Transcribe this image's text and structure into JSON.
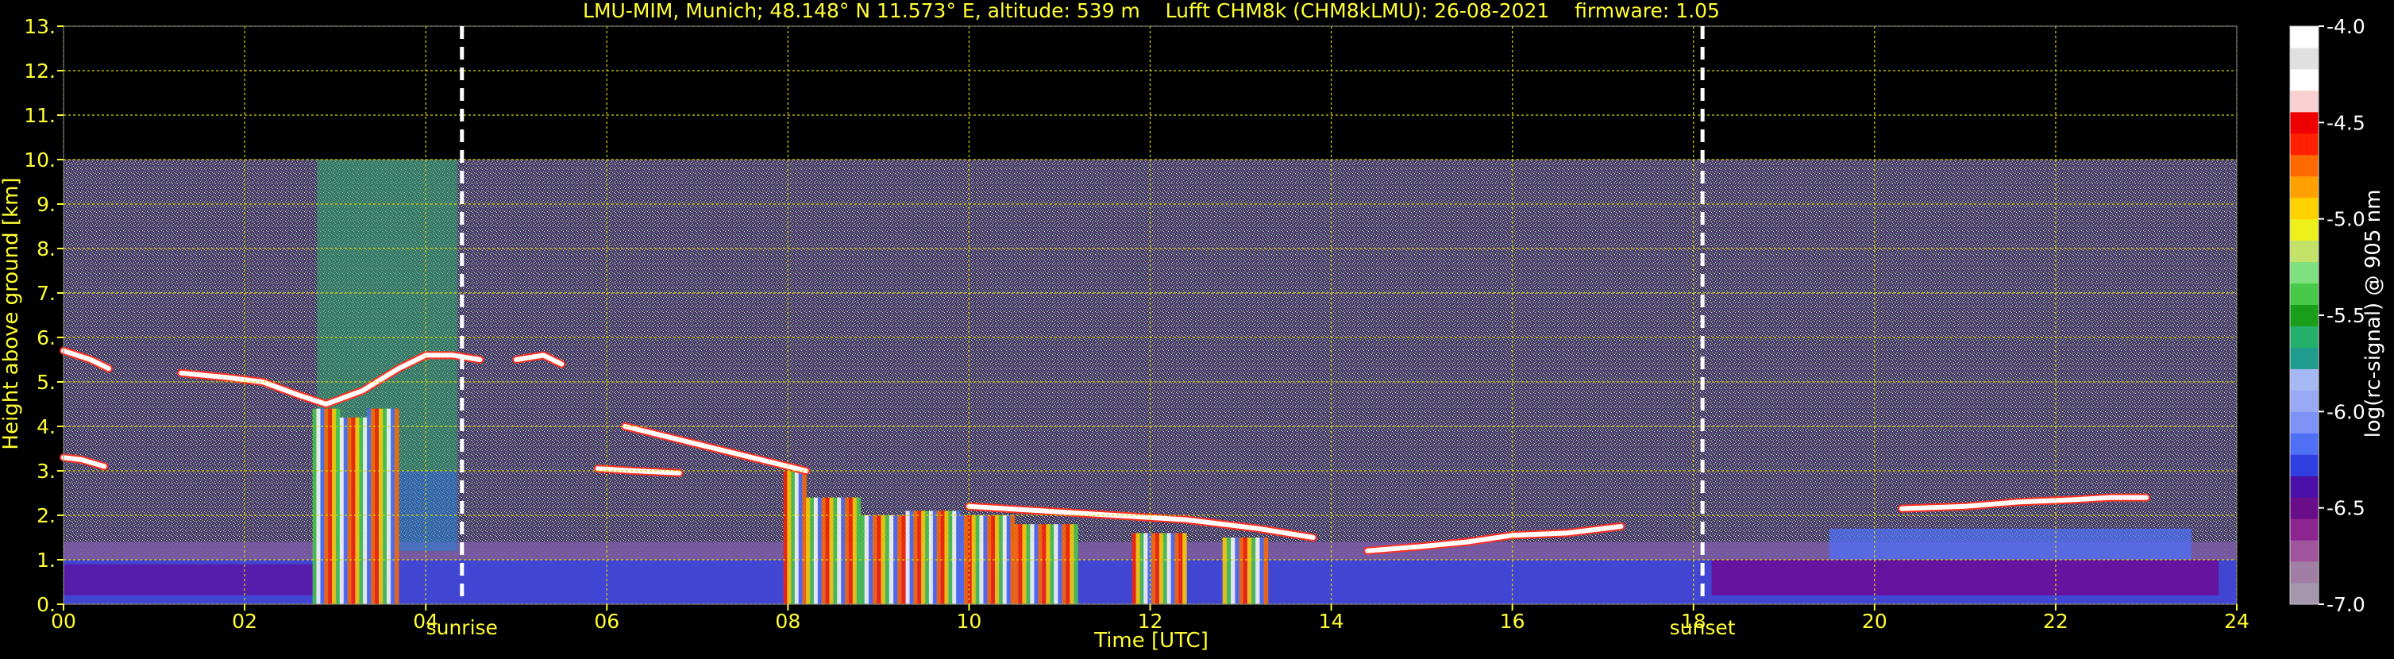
{
  "chart_data": {
    "type": "heatmap",
    "title": "LMU-MIM, Munich; 48.148° N 11.573° E, altitude: 539 m    Lufft CHM8k (CHM8kLMU): 26-08-2021    firmware: 1.05",
    "xlabel": "Time [UTC]",
    "ylabel": "Height above ground [km]",
    "xlim": [
      0,
      24
    ],
    "ylim": [
      0,
      13
    ],
    "xticks": [
      "00",
      "02",
      "04",
      "06",
      "08",
      "10",
      "12",
      "14",
      "16",
      "18",
      "20",
      "22",
      "24"
    ],
    "yticks": [
      "0.",
      "1.",
      "2.",
      "3.",
      "4.",
      "5.",
      "6.",
      "7.",
      "8.",
      "9.",
      "10.",
      "11.",
      "12.",
      "13."
    ],
    "grid": true,
    "max_range_km": 10,
    "markers": [
      {
        "label": "sunrise",
        "time": 4.4
      },
      {
        "label": "sunset",
        "time": 18.1
      }
    ],
    "colorbar": {
      "label": "log(rc-signal) @ 905 nm",
      "range": [
        -7.0,
        -4.0
      ],
      "ticks": [
        "-4.0",
        "-4.5",
        "-5.0",
        "-5.5",
        "-6.0",
        "-6.5",
        "-7.0"
      ],
      "tick_values": [
        -4.0,
        -4.5,
        -5.0,
        -5.5,
        -6.0,
        -6.5,
        -7.0
      ],
      "colors": [
        "#a595ad",
        "#a17fa4",
        "#a0549c",
        "#8c2590",
        "#6a0d8a",
        "#4a10a8",
        "#3040e0",
        "#4f6ff5",
        "#7f93f7",
        "#9aa9f5",
        "#a5b8f3",
        "#1f9c8d",
        "#24b06a",
        "#1a9e1a",
        "#48c94a",
        "#7ee07f",
        "#c4e26a",
        "#eef01c",
        "#ffd200",
        "#ffa000",
        "#ff6a00",
        "#ff2000",
        "#ee0000",
        "#f8d0d0",
        "#ffffff",
        "#e0e0e0",
        "#ffffff"
      ]
    },
    "cloud_layers": [
      {
        "t": [
          0.0,
          0.3,
          0.5
        ],
        "h": [
          5.7,
          5.5,
          5.3
        ]
      },
      {
        "t": [
          1.3,
          1.8,
          2.2,
          2.6,
          2.9,
          3.3,
          3.7,
          4.0,
          4.3,
          4.6
        ],
        "h": [
          5.2,
          5.1,
          5.0,
          4.7,
          4.5,
          4.8,
          5.3,
          5.6,
          5.6,
          5.5
        ]
      },
      {
        "t": [
          5.0,
          5.3,
          5.5
        ],
        "h": [
          5.5,
          5.6,
          5.4
        ]
      },
      {
        "t": [
          0.0,
          0.2,
          0.45
        ],
        "h": [
          3.3,
          3.25,
          3.1
        ]
      },
      {
        "t": [
          6.2,
          6.6,
          7.0,
          7.4,
          7.8,
          8.2
        ],
        "h": [
          4.0,
          3.8,
          3.6,
          3.4,
          3.2,
          3.0
        ]
      },
      {
        "t": [
          5.9,
          6.3,
          6.8
        ],
        "h": [
          3.05,
          3.0,
          2.95
        ]
      },
      {
        "t": [
          10.0,
          10.8,
          11.6,
          12.4,
          13.2,
          13.8
        ],
        "h": [
          2.2,
          2.1,
          2.0,
          1.9,
          1.7,
          1.5
        ]
      },
      {
        "t": [
          14.4,
          15.0,
          15.5,
          16.0,
          16.6,
          17.2
        ],
        "h": [
          1.2,
          1.3,
          1.4,
          1.55,
          1.6,
          1.75
        ]
      },
      {
        "t": [
          20.3,
          21.0,
          21.6,
          22.2,
          22.6,
          23.0
        ],
        "h": [
          2.15,
          2.2,
          2.3,
          2.35,
          2.4,
          2.4
        ]
      }
    ],
    "precip_columns": [
      {
        "t0": 7.95,
        "t1": 8.2,
        "top": 3.0
      },
      {
        "t0": 8.2,
        "t1": 8.8,
        "top": 2.4
      },
      {
        "t0": 8.8,
        "t1": 9.3,
        "top": 2.0
      },
      {
        "t0": 9.3,
        "t1": 9.9,
        "top": 2.1
      },
      {
        "t0": 9.9,
        "t1": 10.5,
        "top": 2.0
      },
      {
        "t0": 10.5,
        "t1": 11.2,
        "top": 1.8
      },
      {
        "t0": 11.8,
        "t1": 12.4,
        "top": 1.6
      },
      {
        "t0": 12.8,
        "t1": 13.3,
        "top": 1.5
      },
      {
        "t0": 2.75,
        "t1": 3.05,
        "top": 4.4
      },
      {
        "t0": 3.05,
        "t1": 3.35,
        "top": 4.2
      },
      {
        "t0": 3.35,
        "t1": 3.7,
        "top": 4.4
      }
    ]
  }
}
